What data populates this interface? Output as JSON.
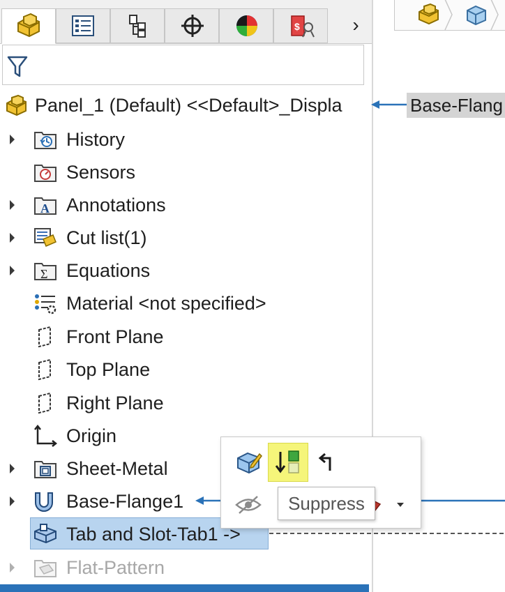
{
  "tree": {
    "root_label": "Panel_1 (Default) <<Default>_Displa",
    "items": [
      {
        "label": "History",
        "expandable": true,
        "icon": "history-folder-icon"
      },
      {
        "label": "Sensors",
        "expandable": false,
        "icon": "sensors-folder-icon"
      },
      {
        "label": "Annotations",
        "expandable": true,
        "icon": "annotations-folder-icon"
      },
      {
        "label": "Cut list(1)",
        "expandable": true,
        "icon": "cut-list-icon"
      },
      {
        "label": "Equations",
        "expandable": true,
        "icon": "equations-folder-icon"
      },
      {
        "label": "Material <not specified>",
        "expandable": false,
        "icon": "material-icon"
      },
      {
        "label": "Front Plane",
        "expandable": false,
        "icon": "plane-icon"
      },
      {
        "label": "Top Plane",
        "expandable": false,
        "icon": "plane-icon"
      },
      {
        "label": "Right Plane",
        "expandable": false,
        "icon": "plane-icon"
      },
      {
        "label": "Origin",
        "expandable": false,
        "icon": "origin-icon"
      },
      {
        "label": "Sheet-Metal",
        "expandable": true,
        "icon": "sheet-metal-icon"
      },
      {
        "label": "Base-Flange1",
        "expandable": true,
        "icon": "base-flange-icon"
      },
      {
        "label": "Tab and Slot-Tab1 ->",
        "expandable": false,
        "icon": "tab-slot-icon",
        "selected": true
      },
      {
        "label": "Flat-Pattern",
        "expandable": true,
        "icon": "flat-pattern-icon",
        "muted": true
      }
    ]
  },
  "tabs": [
    {
      "name": "feature-manager-tab"
    },
    {
      "name": "property-manager-tab"
    },
    {
      "name": "configuration-manager-tab"
    },
    {
      "name": "dimxpert-manager-tab"
    },
    {
      "name": "display-manager-tab"
    },
    {
      "name": "cam-manager-tab"
    }
  ],
  "graphics": {
    "callout_text": "Base-Flang"
  },
  "context_toolbar": {
    "tooltip": "Suppress"
  },
  "colors": {
    "selection": "#b8d4ef",
    "accent": "#2a72b8",
    "highlight": "#f5f57a"
  }
}
